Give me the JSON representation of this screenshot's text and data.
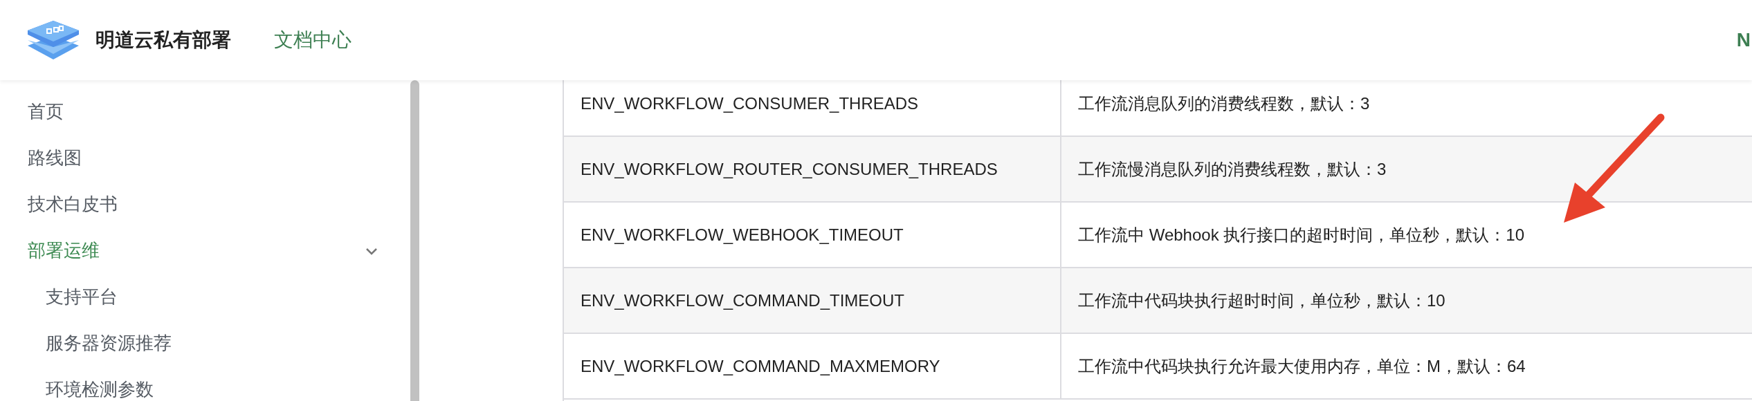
{
  "header": {
    "site_title": "明道云私有部署",
    "nav": [
      {
        "label": "文档中心",
        "selected": true
      }
    ],
    "right_text": "N"
  },
  "sidebar": {
    "items": [
      {
        "label": "首页",
        "selected": false
      },
      {
        "label": "路线图",
        "selected": false
      },
      {
        "label": "技术白皮书",
        "selected": false
      },
      {
        "label": "部署运维",
        "selected": true,
        "expanded": true,
        "children": [
          {
            "label": "支持平台",
            "selected": false
          },
          {
            "label": "服务器资源推荐",
            "selected": false
          },
          {
            "label": "环境检测参数",
            "selected": false
          }
        ]
      }
    ]
  },
  "table": {
    "rows": [
      [
        "ENV_WORKFLOW_CONSUMER_THREADS",
        "工作流消息队列的消费线程数，默认：3"
      ],
      [
        "ENV_WORKFLOW_ROUTER_CONSUMER_THREADS",
        "工作流慢消息队列的消费线程数，默认：3"
      ],
      [
        "ENV_WORKFLOW_WEBHOOK_TIMEOUT",
        "工作流中 Webhook 执行接口的超时时间，单位秒，默认：10"
      ],
      [
        "ENV_WORKFLOW_COMMAND_TIMEOUT",
        "工作流中代码块执行超时时间，单位秒，默认：10"
      ],
      [
        "ENV_WORKFLOW_COMMAND_MAXMEMORY",
        "工作流中代码块执行允许最大使用内存，单位：M，默认：64"
      ]
    ]
  }
}
